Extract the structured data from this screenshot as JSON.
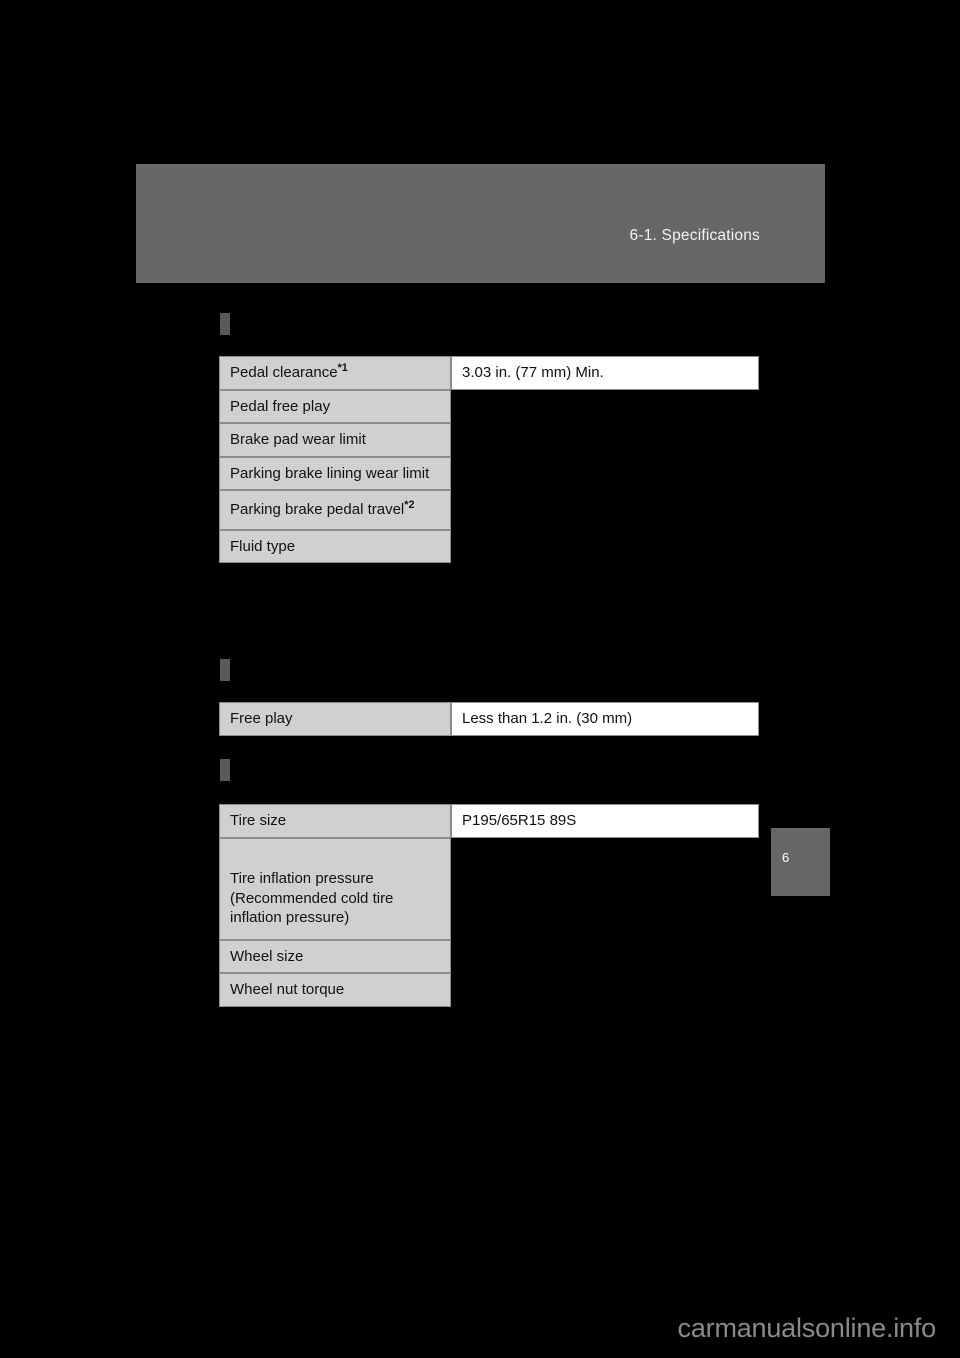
{
  "page": {
    "header_title": "6-1. Specifications",
    "tab_number": "6",
    "watermark": "carmanualsonline.info"
  },
  "sections": [
    {
      "heading": "",
      "table": {
        "rows": [
          {
            "label": "Pedal clearance",
            "sup": "*1",
            "value": "3.03 in. (77 mm) Min.",
            "value_visible": true
          },
          {
            "label": "Pedal free play",
            "sup": "",
            "value": "",
            "value_visible": false
          },
          {
            "label": "Brake pad wear limit",
            "sup": "",
            "value": "",
            "value_visible": false
          },
          {
            "label": "Parking brake lining wear limit",
            "sup": "",
            "value": "",
            "value_visible": false
          },
          {
            "label": "Parking brake pedal travel",
            "sup": "*2",
            "value": "",
            "value_visible": false
          },
          {
            "label": "Fluid type",
            "sup": "",
            "value": "",
            "value_visible": false
          }
        ]
      }
    },
    {
      "heading": "",
      "table": {
        "rows": [
          {
            "label": "Free play",
            "sup": "",
            "value": "Less than 1.2 in. (30 mm)",
            "value_visible": true
          }
        ]
      }
    },
    {
      "heading": "",
      "table": {
        "rows": [
          {
            "label": "Tire size",
            "sup": "",
            "value": "P195/65R15 89S",
            "value_visible": true
          },
          {
            "label": "Tire inflation pressure\n(Recommended cold tire\ninflation pressure)",
            "sup": "",
            "value": "",
            "value_visible": false
          },
          {
            "label": "Wheel size",
            "sup": "",
            "value": "",
            "value_visible": false
          },
          {
            "label": "Wheel nut torque",
            "sup": "",
            "value": "",
            "value_visible": false
          }
        ]
      }
    }
  ],
  "colors": {
    "page_background": "#000000",
    "header_band": "#666666",
    "label_cell": "#d0d0d0",
    "value_cell": "#ffffff",
    "marker": "#595959",
    "watermark": "#8a8a8a"
  }
}
